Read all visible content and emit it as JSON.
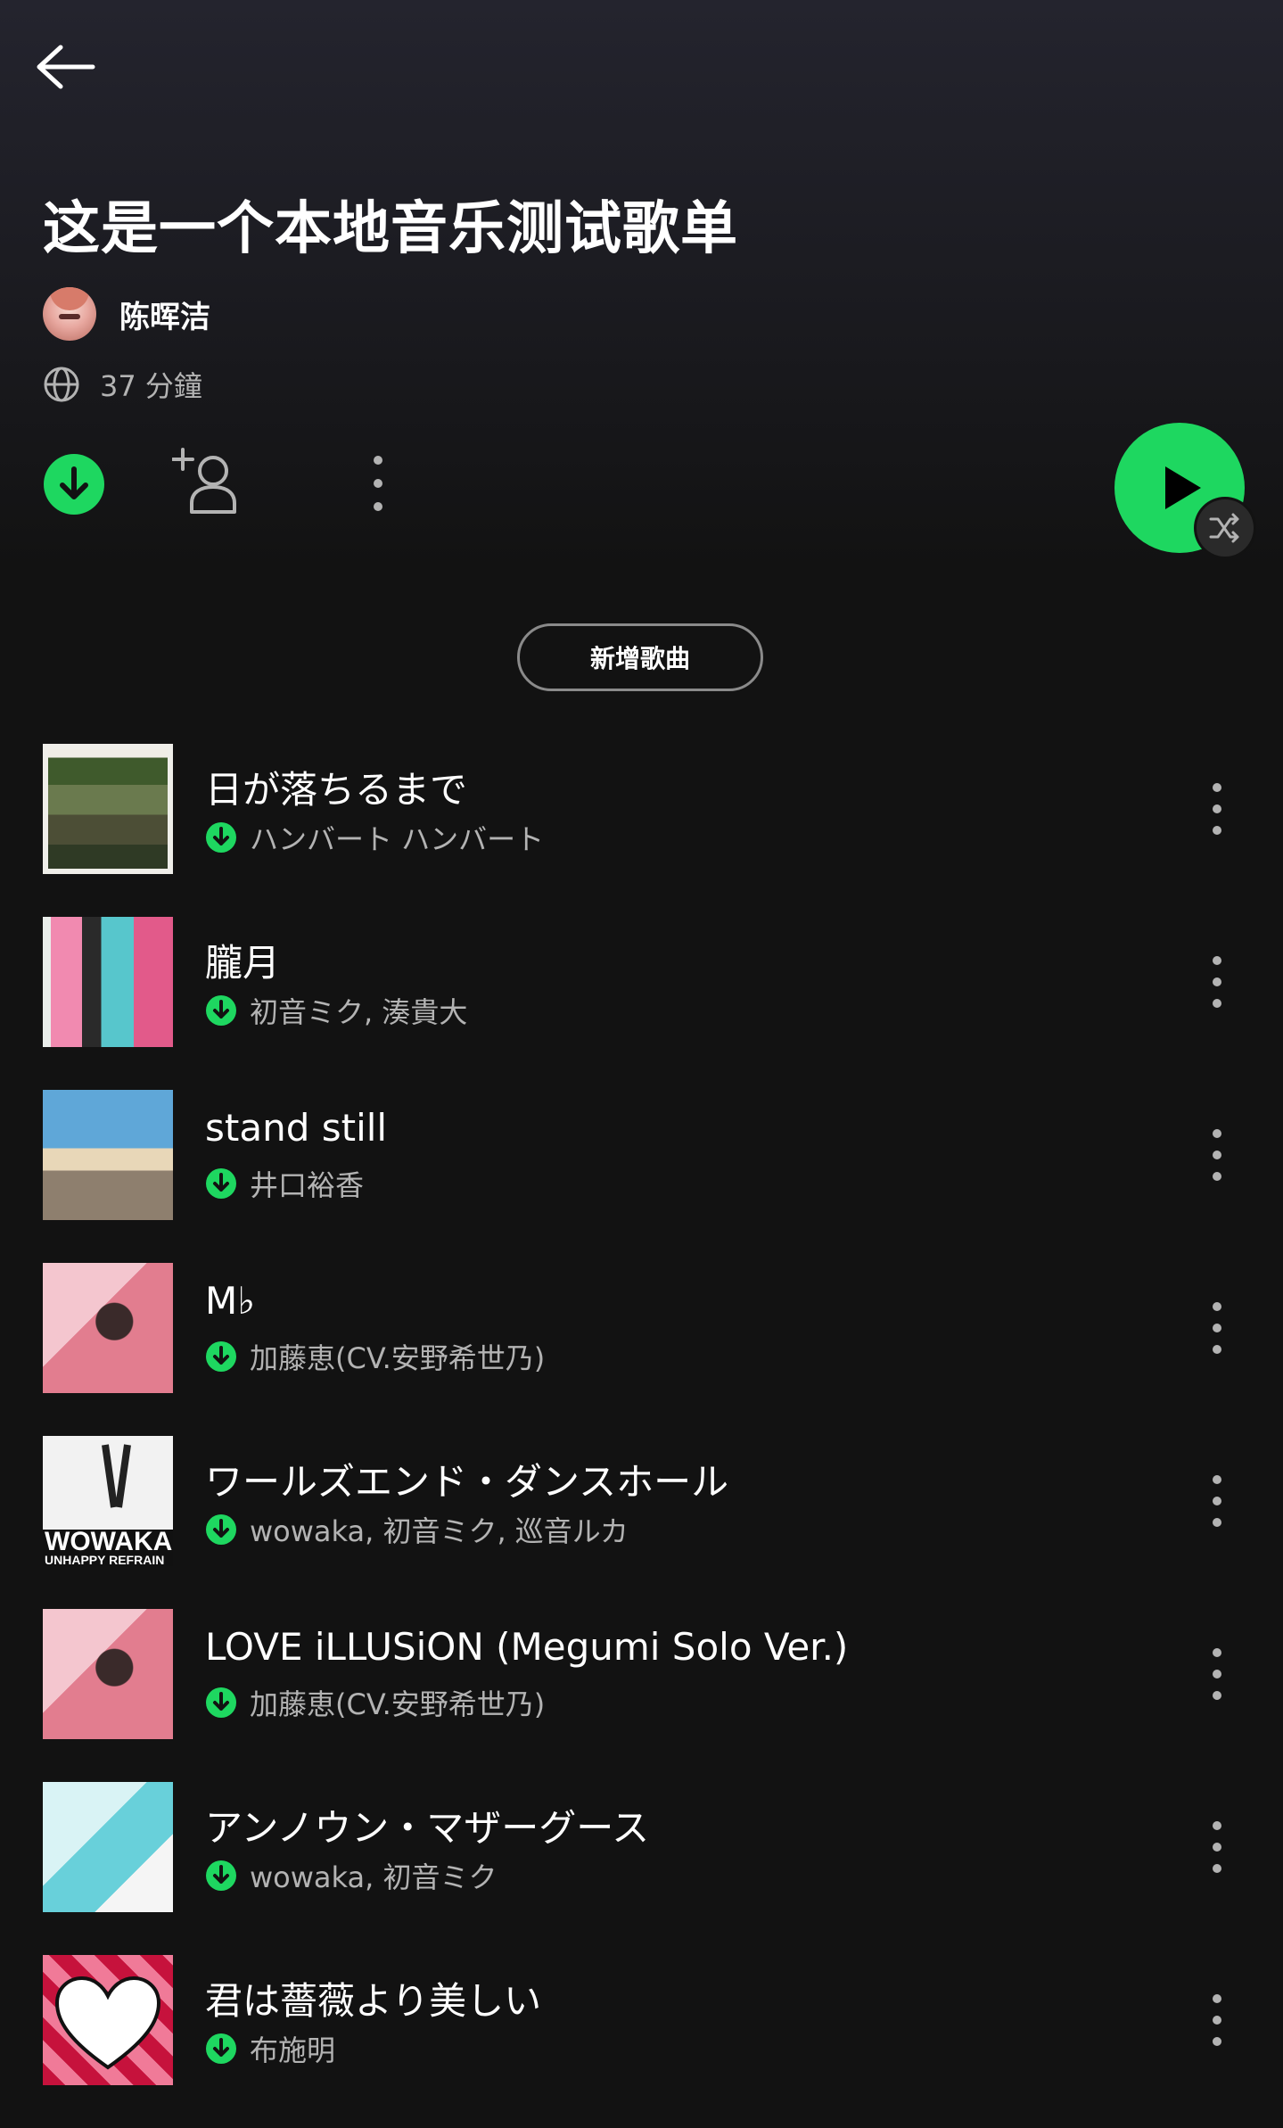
{
  "header": {
    "back_label": "Back",
    "title": "这是一个本地音乐测试歌单",
    "owner_name": "陈晖洁",
    "duration": "37 分鐘"
  },
  "actions": {
    "add_songs_label": "新增歌曲"
  },
  "colors": {
    "accent": "#1ed760",
    "background": "#121212",
    "secondary_text": "#b3b3b3"
  },
  "tracks": [
    {
      "title": "日が落ちるまで",
      "artist": "ハンバート ハンバート",
      "downloaded": true
    },
    {
      "title": "朧月",
      "artist": "初音ミク, 湊貴大",
      "downloaded": true
    },
    {
      "title": "stand still",
      "artist": "井口裕香",
      "downloaded": true
    },
    {
      "title": "M♭",
      "artist": "加藤恵(CV.安野希世乃)",
      "downloaded": true
    },
    {
      "title": "ワールズエンド・ダンスホール",
      "artist": "wowaka, 初音ミク, 巡音ルカ",
      "downloaded": true,
      "cover_text": "WOWAKA",
      "cover_subtext": "UNHAPPY REFRAIN"
    },
    {
      "title": "LOVE iLLUSiON (Megumi Solo Ver.)",
      "artist": "加藤恵(CV.安野希世乃)",
      "downloaded": true
    },
    {
      "title": "アンノウン・マザーグース",
      "artist": "wowaka, 初音ミク",
      "downloaded": true
    },
    {
      "title": "君は薔薇より美しい",
      "artist": "布施明",
      "downloaded": true
    }
  ]
}
